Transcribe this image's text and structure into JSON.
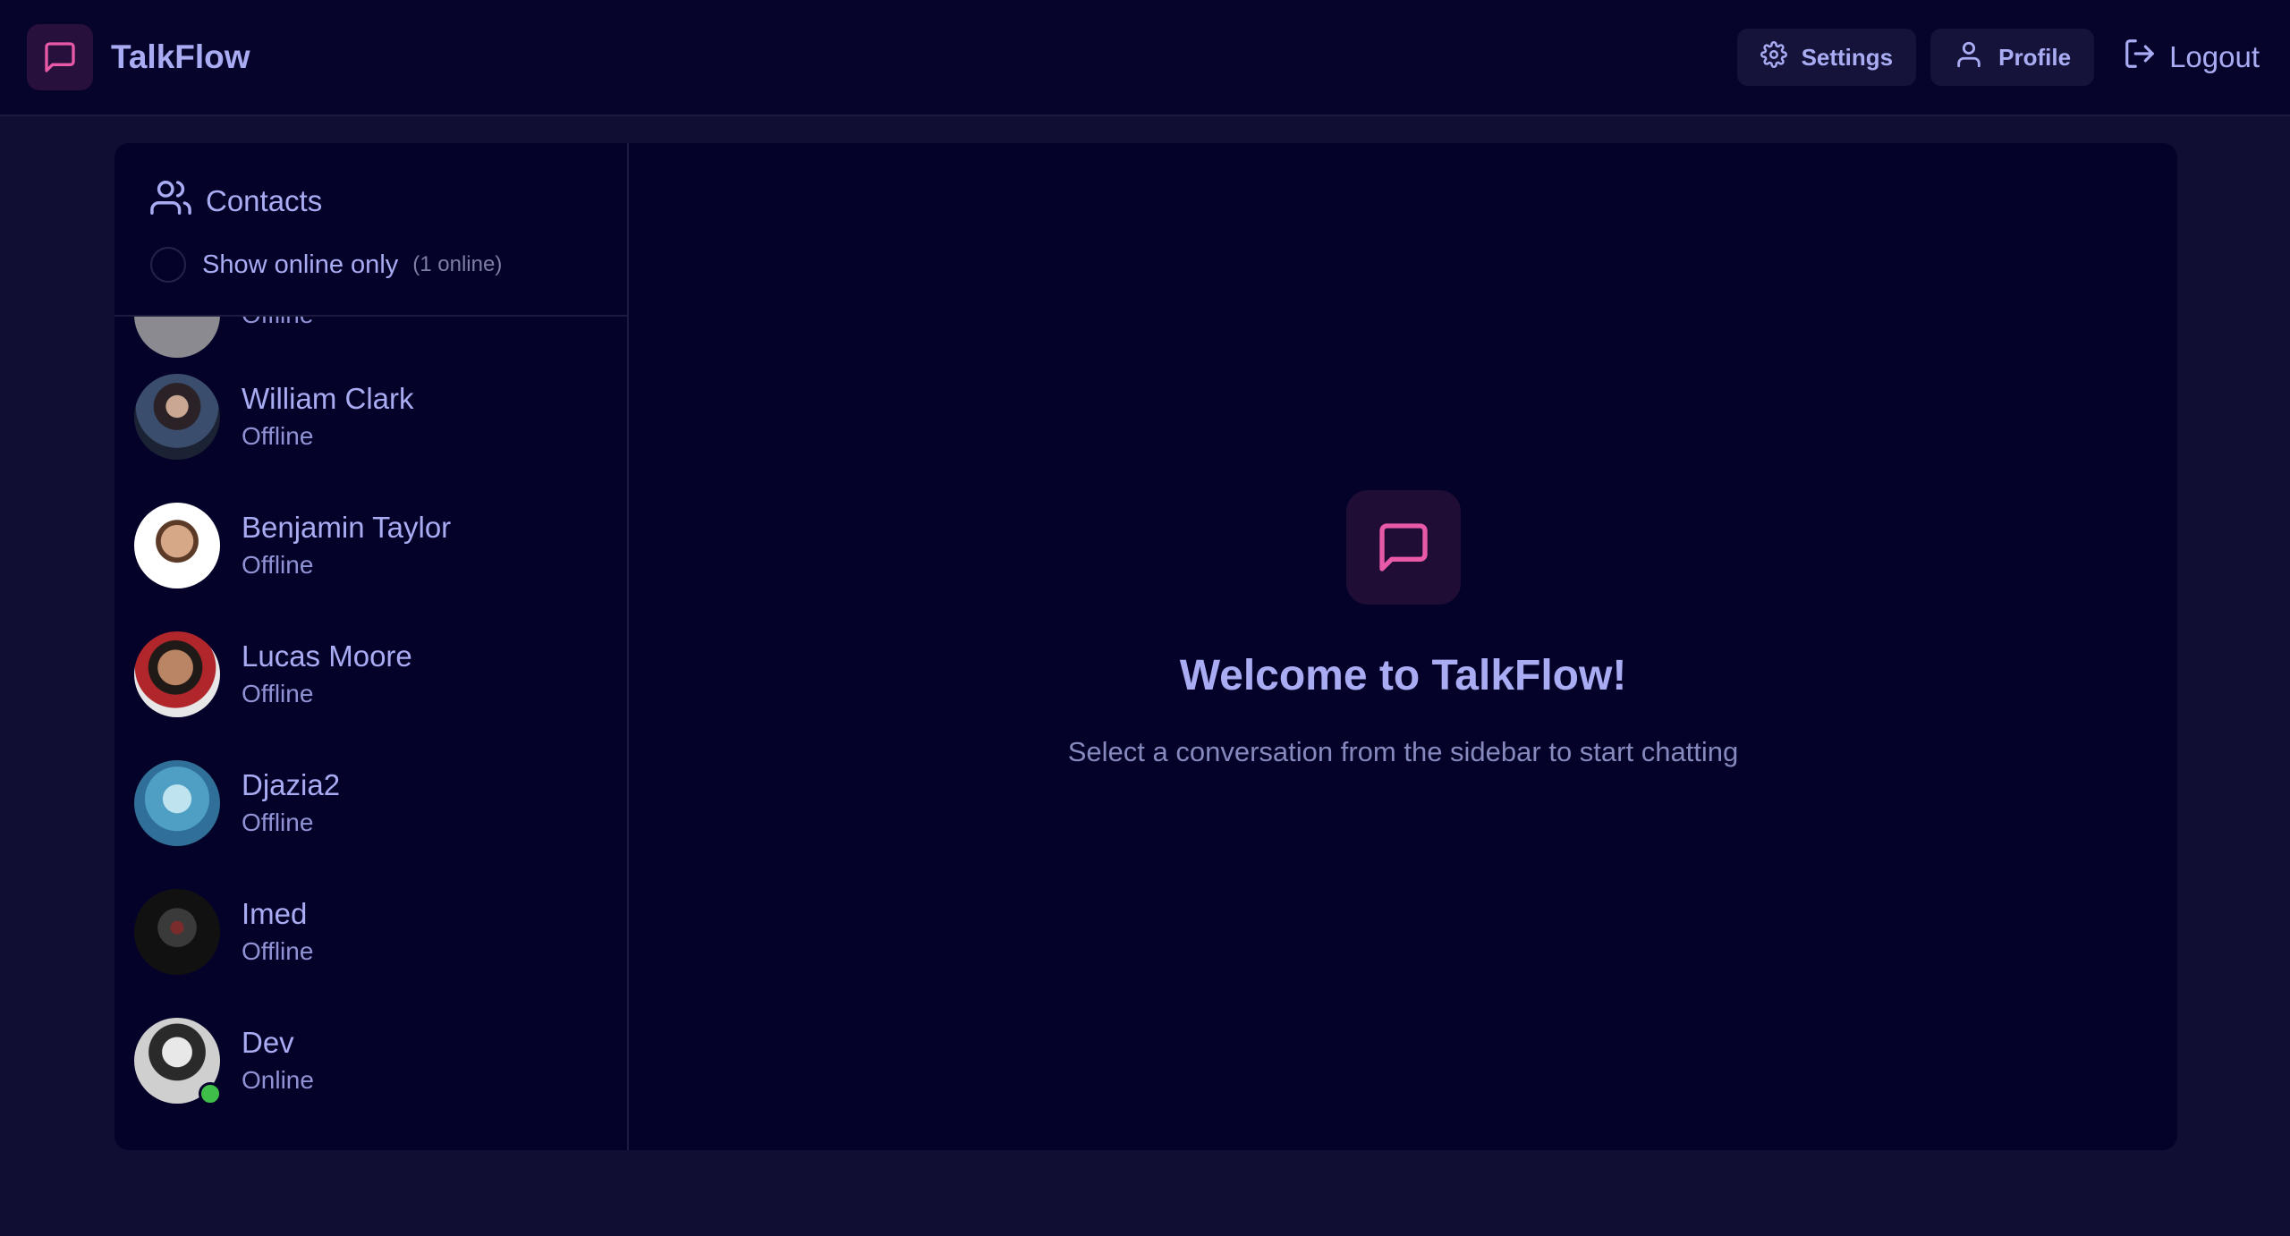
{
  "app": {
    "name": "TalkFlow"
  },
  "nav": {
    "settings_label": "Settings",
    "profile_label": "Profile",
    "logout_label": "Logout"
  },
  "sidebar": {
    "title": "Contacts",
    "filter_label": "Show online only",
    "online_count": "(1 online)",
    "partial_status": "Offline",
    "contacts": [
      {
        "name": "William Clark",
        "status": "Offline"
      },
      {
        "name": "Benjamin Taylor",
        "status": "Offline"
      },
      {
        "name": "Lucas Moore",
        "status": "Offline"
      },
      {
        "name": "Djazia2",
        "status": "Offline"
      },
      {
        "name": "Imed",
        "status": "Offline"
      },
      {
        "name": "Dev",
        "status": "Online"
      }
    ]
  },
  "main": {
    "welcome_title": "Welcome to TalkFlow!",
    "welcome_subtitle": "Select a conversation from the sidebar to start chatting"
  },
  "colors": {
    "accent": "#e85aa8",
    "online": "#3fbf4a",
    "text": "#a9acf3"
  },
  "icons": {
    "brand": "message-square-icon",
    "settings": "gear-icon",
    "profile": "user-icon",
    "logout": "logout-icon",
    "contacts": "users-icon"
  }
}
